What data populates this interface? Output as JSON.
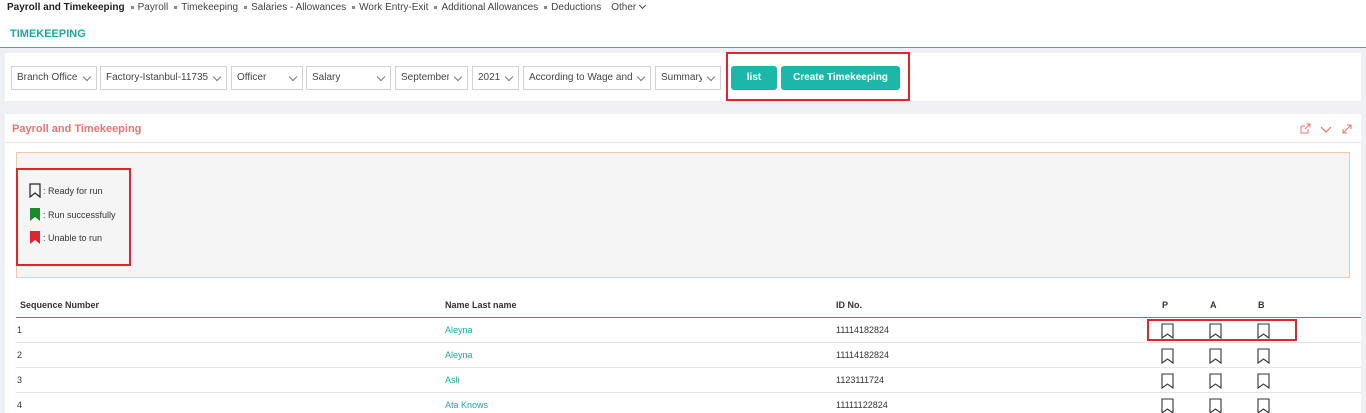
{
  "topnav": {
    "items": [
      "Payroll and Timekeeping",
      "Payroll",
      "Timekeeping",
      "Salaries - Allowances",
      "Work Entry-Exit",
      "Additional Allowances",
      "Deductions"
    ],
    "other_label": "Other"
  },
  "page": {
    "title": "TIMEKEEPING"
  },
  "filters": {
    "branch": "Branch Office",
    "factory": "Factory-Istanbul-11735(",
    "officer": "Officer",
    "salary": "Salary",
    "month": "September",
    "year": "2021",
    "wage": "According to Wage and",
    "summary": "Summary"
  },
  "buttons": {
    "list": "list",
    "create": "Create Timekeeping"
  },
  "panel": {
    "title": "Payroll and Timekeeping"
  },
  "legend": {
    "ready": ": Ready for run",
    "success": ": Run successfully",
    "unable": ": Unable to run"
  },
  "colors": {
    "accent": "#1db7aa",
    "success": "#1a8a2a",
    "error": "#e0252f",
    "panel_title": "#e57570"
  },
  "table": {
    "headers": {
      "seq": "Sequence Number",
      "name": "Name Last name",
      "id": "ID No.",
      "p": "P",
      "a": "A",
      "b": "B"
    },
    "rows": [
      {
        "seq": "1",
        "name": "Aleyna",
        "id": "11114182824"
      },
      {
        "seq": "2",
        "name": "Aleyna",
        "id": "11114182824"
      },
      {
        "seq": "3",
        "name": "Asli",
        "id": "1123111724"
      },
      {
        "seq": "4",
        "name": "Ata Knows",
        "id": "11111122824"
      }
    ]
  }
}
